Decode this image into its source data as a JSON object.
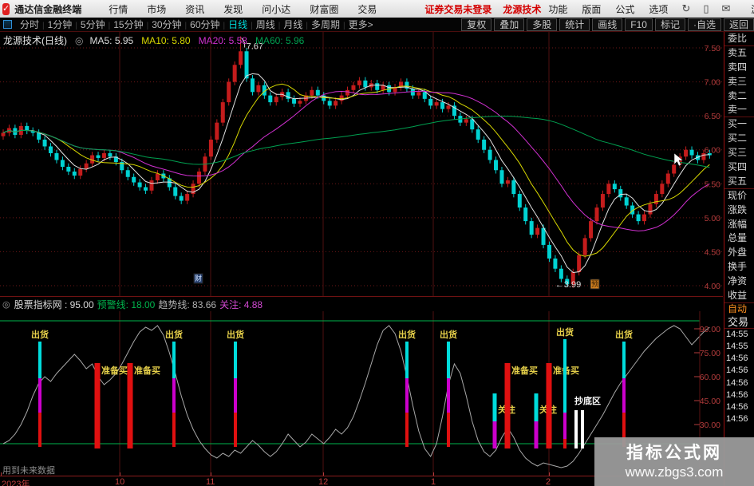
{
  "titlebar": {
    "app_name": "通达信金融终端",
    "menus": [
      "行情",
      "市场",
      "资讯",
      "发现",
      "问小达",
      "财富圈",
      "交易"
    ],
    "alert": "证券交易未登录",
    "stock_shortcut": "龙源技术",
    "right_menus": [
      "功能",
      "版面",
      "公式",
      "选项"
    ],
    "icons": [
      {
        "name": "refresh-icon",
        "glyph": "↻"
      },
      {
        "name": "phone-icon",
        "glyph": "▯"
      },
      {
        "name": "mail-icon",
        "glyph": "✉"
      }
    ],
    "user": "游客"
  },
  "toolbar": {
    "periods": [
      {
        "label": "分时",
        "active": false
      },
      {
        "label": "1分钟",
        "active": false
      },
      {
        "label": "5分钟",
        "active": false
      },
      {
        "label": "15分钟",
        "active": false
      },
      {
        "label": "30分钟",
        "active": false
      },
      {
        "label": "60分钟",
        "active": false
      },
      {
        "label": "日线",
        "active": true
      },
      {
        "label": "周线",
        "active": false
      },
      {
        "label": "月线",
        "active": false
      },
      {
        "label": "多周期",
        "active": false
      },
      {
        "label": "更多>",
        "active": false
      }
    ],
    "right_buttons": [
      "复权",
      "叠加",
      "多股",
      "统计",
      "画线",
      "F10",
      "标记",
      "·自选",
      "返回"
    ]
  },
  "main_chart": {
    "title": "龙源技术(日线)",
    "ma_labels": [
      {
        "text": "MA5: 5.95",
        "color": "#dcdcdc"
      },
      {
        "text": "MA10: 5.80",
        "color": "#d6d600"
      },
      {
        "text": "MA20: 5.58",
        "color": "#d030d0"
      },
      {
        "text": "MA60: 5.96",
        "color": "#00a050"
      }
    ],
    "peak_label": "7.67",
    "low_label": "←3.99",
    "event_markers": [
      {
        "text": "财",
        "x": 243,
        "y": 354,
        "bg": "#27406e",
        "fg": "#cfe2ff"
      },
      {
        "text": "预",
        "x": 740,
        "y": 361,
        "bg": "#d38220",
        "fg": "#2a1600"
      }
    ],
    "y_axis_labels": [
      "7.50",
      "7.00",
      "6.50",
      "6.00",
      "5.50",
      "5.00",
      "4.50",
      "4.00"
    ]
  },
  "indicator": {
    "header": [
      {
        "text": "股票指标网 : 95.00",
        "color": "#d8d8d8"
      },
      {
        "text": "预警线: 18.00",
        "color": "#00b44c"
      },
      {
        "text": "趋势线: 83.66",
        "color": "#b0b0b0"
      },
      {
        "text": "关注: 4.88",
        "color": "#d048d0"
      }
    ],
    "y_axis_labels": [
      "90.00",
      "75.00",
      "60.00",
      "45.00",
      "30.00"
    ],
    "footnote": "用到未来数据",
    "signals": [
      {
        "x": 50,
        "kind": "sell",
        "label": "出货"
      },
      {
        "x": 122,
        "kind": "prebuy",
        "label": "准备买"
      },
      {
        "x": 163,
        "kind": "prebuy",
        "label": "准备买"
      },
      {
        "x": 218,
        "kind": "sell",
        "label": "出货"
      },
      {
        "x": 295,
        "kind": "sell",
        "label": "出货"
      },
      {
        "x": 510,
        "kind": "sell",
        "label": "出货"
      },
      {
        "x": 562,
        "kind": "sell",
        "label": "出货"
      },
      {
        "x": 620,
        "kind": "watch",
        "label": "关注"
      },
      {
        "x": 636,
        "kind": "prebuy",
        "label": "准备买"
      },
      {
        "x": 672,
        "kind": "watch",
        "label": "关注"
      },
      {
        "x": 688,
        "kind": "prebuy",
        "label": "准备买"
      },
      {
        "x": 708,
        "kind": "sell_tall",
        "label": "出货"
      },
      {
        "x": 722,
        "kind": "bottom",
        "label": "抄底区"
      },
      {
        "x": 730,
        "kind": "bottom",
        "label": ""
      },
      {
        "x": 782,
        "kind": "sell",
        "label": "出货"
      }
    ]
  },
  "sidebar": {
    "rows": [
      "委比",
      "卖五",
      "卖四",
      "卖三",
      "卖二",
      "卖一",
      "买一",
      "买二",
      "买三",
      "买四",
      "买五",
      "现价",
      "涨跌",
      "涨幅",
      "总量",
      "外盘",
      "换手",
      "净资",
      "收益"
    ],
    "separators_after": [
      0,
      5,
      10,
      18
    ],
    "auto_tab": "自动",
    "trade_tab": "交易",
    "times": [
      "14:55",
      "14:55",
      "14:56",
      "14:56",
      "14:56",
      "14:56",
      "14:56",
      "14:56"
    ]
  },
  "x_axis": {
    "labels": [
      {
        "text": "2023年",
        "x": 2
      },
      {
        "text": "10",
        "x": 144
      },
      {
        "text": "11",
        "x": 258
      },
      {
        "text": "12",
        "x": 399
      },
      {
        "text": "1",
        "x": 540
      },
      {
        "text": "2",
        "x": 684
      }
    ],
    "tick_x": [
      1,
      150,
      264,
      405,
      543,
      688
    ]
  },
  "watermark": {
    "line1": "指标公式网",
    "line2": "www.zbgs3.com"
  },
  "colors": {
    "candle_up": "#c41c1c",
    "candle_down": "#00d2d2",
    "ma5": "#e2e2e2",
    "ma10": "#d6d600",
    "ma20": "#d030d0",
    "ma60": "#00a050",
    "grid_red": "#6b1717",
    "axis_red": "#b43c3c",
    "green_line": "#00b44c",
    "signal_cyan": "#00dcdc",
    "signal_magenta": "#cc00cc",
    "signal_red": "#e01010",
    "signal_label": "#e6d04a",
    "curve_gray": "#a8a8a8"
  },
  "chart_data": {
    "type": "candlestick+line",
    "title": "龙源技术(日线)",
    "price_gridlines": [
      7.5,
      7.0,
      6.5,
      6.0,
      5.5,
      5.0,
      4.5,
      4.0
    ],
    "price_ylim": [
      3.85,
      7.75
    ],
    "month_gridline_x": [
      150,
      264,
      405,
      543,
      688
    ],
    "peak": {
      "index": 40,
      "high": 7.67
    },
    "low": {
      "index": 95,
      "low": 3.99
    },
    "closes": [
      6.25,
      6.32,
      6.22,
      6.35,
      6.28,
      6.25,
      6.15,
      6.05,
      5.95,
      5.85,
      5.75,
      5.68,
      5.62,
      5.72,
      5.8,
      5.92,
      5.88,
      5.95,
      5.9,
      5.82,
      5.7,
      5.6,
      5.52,
      5.45,
      5.4,
      5.55,
      5.65,
      5.58,
      5.45,
      5.32,
      5.25,
      5.35,
      5.5,
      5.68,
      5.9,
      6.15,
      6.4,
      6.7,
      7.0,
      7.25,
      7.45,
      7.05,
      6.85,
      6.95,
      6.8,
      6.7,
      6.78,
      6.85,
      6.75,
      6.68,
      6.72,
      6.8,
      6.88,
      6.8,
      6.72,
      6.65,
      6.72,
      6.8,
      6.88,
      6.95,
      7.02,
      6.92,
      6.98,
      6.88,
      6.95,
      6.85,
      6.92,
      7.0,
      6.9,
      6.8,
      6.85,
      6.75,
      6.65,
      6.7,
      6.6,
      6.65,
      6.5,
      6.4,
      6.45,
      6.3,
      6.15,
      6.0,
      5.85,
      5.7,
      5.5,
      5.55,
      5.35,
      5.15,
      4.95,
      4.75,
      4.85,
      4.6,
      4.4,
      4.25,
      4.1,
      4.02,
      4.2,
      4.45,
      4.7,
      4.95,
      5.15,
      5.35,
      5.5,
      5.42,
      5.3,
      5.18,
      5.05,
      4.95,
      5.05,
      5.2,
      5.35,
      5.5,
      5.65,
      5.78,
      5.9,
      6.0,
      5.92,
      5.85,
      5.95,
      5.92
    ],
    "indicator": {
      "name": "股票指标网",
      "upper_line": 95,
      "lower_line": 18,
      "trend_value": 83.66,
      "watch_value": 4.88,
      "ylim": [
        0,
        100
      ],
      "grid_values": [
        90,
        75,
        60,
        45,
        30
      ],
      "values": [
        18,
        20,
        24,
        30,
        38,
        48,
        56,
        60,
        57,
        62,
        66,
        70,
        74,
        70,
        65,
        68,
        60,
        55,
        58,
        62,
        68,
        75,
        82,
        88,
        91,
        89,
        92,
        86,
        75,
        62,
        48,
        36,
        27,
        20,
        15,
        11,
        9,
        12,
        10,
        14,
        12,
        16,
        20,
        17,
        13,
        10,
        13,
        18,
        24,
        20,
        16,
        19,
        24,
        21,
        18,
        22,
        27,
        24,
        28,
        35,
        45,
        56,
        68,
        80,
        89,
        92,
        87,
        76,
        60,
        42,
        26,
        15,
        10,
        18,
        35,
        55,
        68,
        62,
        48,
        32,
        20,
        13,
        10,
        14,
        22,
        28,
        22,
        14,
        9,
        6,
        4,
        6,
        5,
        4,
        3,
        4,
        7,
        12,
        18,
        24,
        30,
        36,
        43,
        50,
        56,
        61,
        66,
        71,
        76,
        80,
        84,
        87,
        90,
        92,
        90,
        85,
        80,
        84,
        88,
        91
      ]
    }
  }
}
